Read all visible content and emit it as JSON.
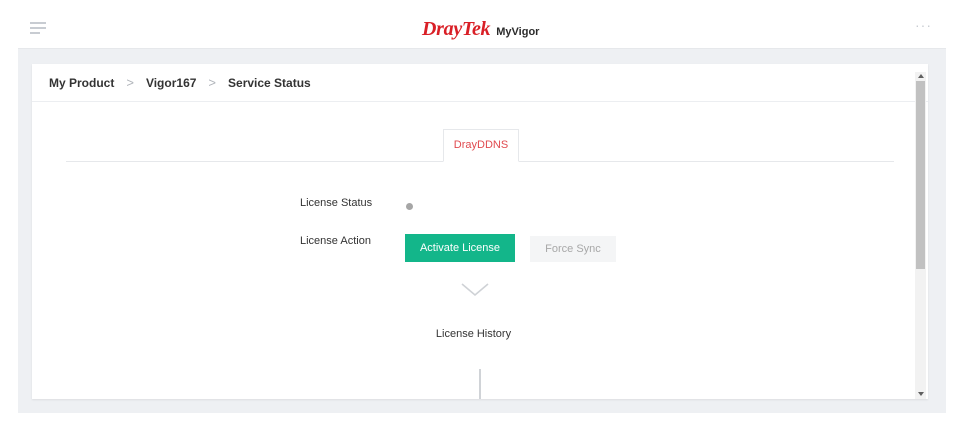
{
  "header": {
    "brand_logo": "DrayTek",
    "brand_app": "MyVigor",
    "menu_icon": "hamburger-menu-icon",
    "more_icon": "more-dots-icon",
    "accent_color": "#d91f26"
  },
  "breadcrumb": {
    "items": [
      "My Product",
      "Vigor167",
      "Service Status"
    ],
    "separator": ">"
  },
  "tabs": [
    {
      "label": "DrayDDNS",
      "active": true
    }
  ],
  "license": {
    "status_label": "License Status",
    "action_label": "License Action",
    "status_color": "#a6a6a6",
    "activate_label": "Activate License",
    "activate_color": "#13b68a",
    "force_sync_label": "Force Sync",
    "history_label": "License History"
  }
}
